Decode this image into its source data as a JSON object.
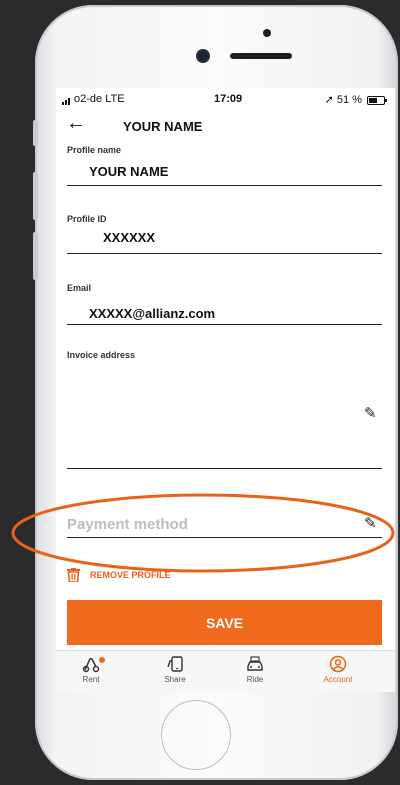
{
  "status": {
    "carrier": "o2-de  LTE",
    "time": "17:09",
    "battery": "51 %"
  },
  "header": {
    "back_label": "←",
    "title": "YOUR NAME"
  },
  "form": {
    "profile_name_label": "Profile name",
    "profile_name_value": "YOUR NAME",
    "profile_id_label": "Profile ID",
    "profile_id_value": "XXXXXX",
    "email_label": "Email",
    "email_value": "XXXXX@allianz.com",
    "invoice_label": "Invoice address",
    "payment_placeholder": "Payment method"
  },
  "actions": {
    "remove_label": "REMOVE PROFILE",
    "save_label": "SAVE"
  },
  "tabs": [
    {
      "label": "Rent",
      "icon": "scooter-icon"
    },
    {
      "label": "Share",
      "icon": "share-icon"
    },
    {
      "label": "Ride",
      "icon": "taxi-icon"
    },
    {
      "label": "Account",
      "icon": "account-icon"
    }
  ],
  "colors": {
    "accent": "#f06a1e",
    "annotation": "#e8631a"
  }
}
